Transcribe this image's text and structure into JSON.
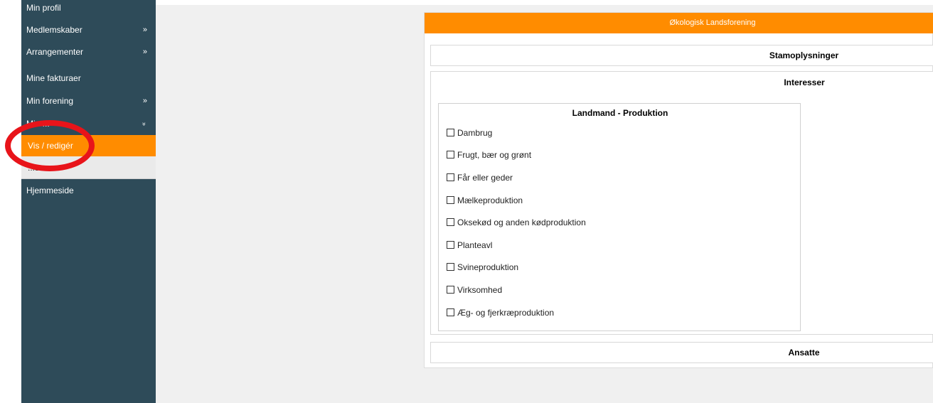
{
  "sidebar": {
    "items": [
      {
        "label": "Min profil",
        "chevron": ""
      },
      {
        "label": "Medlemskaber",
        "chevron": "»"
      },
      {
        "label": "Arrangementer",
        "chevron": "»"
      },
      {
        "label": "Mine fakturaer",
        "chevron": ""
      },
      {
        "label": "Min forening",
        "chevron": "»"
      },
      {
        "label": "Min ...",
        "chevron": "»"
      }
    ],
    "subitems": [
      {
        "label": "Vis / redigér",
        "active": true
      },
      {
        "label": "...s..."
      }
    ],
    "homepage": "Hjemmeside"
  },
  "panel": {
    "header": "Økologisk Landsforening",
    "sections": {
      "stamoplysninger": "Stamoplysninger",
      "interesser": "Interesser",
      "ansatte": "Ansatte"
    },
    "group": {
      "title": "Landmand - Produktion",
      "options": [
        "Dambrug",
        "Frugt, bær og grønt",
        "Får eller geder",
        "Mælkeproduktion",
        "Oksekød og anden kødproduktion",
        "Planteavl",
        "Svineproduktion",
        "Virksomhed",
        "Æg- og fjerkræproduktion"
      ]
    }
  },
  "colors": {
    "sidebar": "#2e4b59",
    "accent": "#ff8c00",
    "highlight_ring": "#e8141a"
  }
}
